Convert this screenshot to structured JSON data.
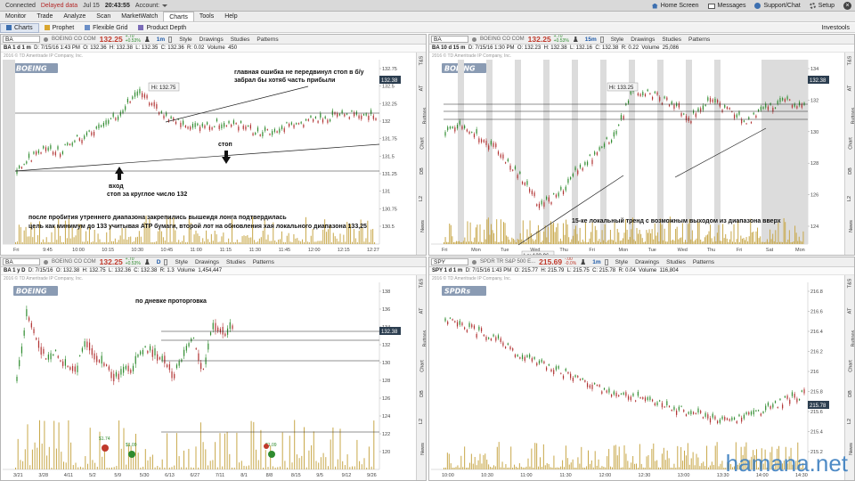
{
  "topbar": {
    "connected": "Connected",
    "delayed": "Delayed data",
    "date": "Jul 15",
    "time": "20:43:55",
    "account_label": "Account:",
    "home": "Home Screen",
    "messages": "Messages",
    "support": "Support/Chat",
    "setup": "Setup"
  },
  "main_tabs": [
    "Monitor",
    "Trade",
    "Analyze",
    "Scan",
    "MarketWatch",
    "Charts",
    "Tools",
    "Help"
  ],
  "active_tab": "Charts",
  "subnav": {
    "items": [
      "Charts",
      "Prophet",
      "Flexible Grid",
      "Product Depth"
    ],
    "right": "Investools"
  },
  "panes": [
    {
      "symbol": "BA",
      "period": "BA 1 d 1 m",
      "company": "BOEING CO COM",
      "last": "132.25",
      "change": "+.70",
      "change_pct": "+0.53%",
      "interval": "1m",
      "ohlc": {
        "date": "D: 7/15/16 1:43 PM",
        "o": "O: 132.36",
        "h": "H: 132.38",
        "l": "L: 132.35",
        "c": "C: 132.36",
        "r": "R: 0.02",
        "vol_label": "Volume",
        "vol": "450"
      },
      "price_tag": "132.38",
      "hi_label": "Hi: 132.75",
      "y_ticks": [
        "132.75",
        "132.5",
        "132.25",
        "132",
        "131.75",
        "131.5",
        "131.25",
        "131",
        "130.75",
        "130.5"
      ],
      "x_ticks": [
        "Fri",
        "9:45",
        "10:00",
        "10:15",
        "10:30",
        "10:45",
        "11:00",
        "11:15",
        "11:30",
        "11:45",
        "12:00",
        "12:15",
        "12:27"
      ],
      "notes": {
        "error": "главная ошибка  не передвинул стоп в б/у",
        "error2": "забрал бы хотяб часть прибыли",
        "stop": "стоп",
        "entry": "вход",
        "entry2": "стоп за круглое число 132",
        "after": "после пробития утреннего диапазона закрепились вышеидя лонга подтвердилась",
        "after2": "цель как минимум до 133 учитывая ATP бумаги, второй лот на обновления хая локального диапазона 133,25"
      }
    },
    {
      "symbol": "BA",
      "period": "BA 10 d 15 m",
      "company": "BOEING CO COM",
      "last": "132.25",
      "change": "+.70",
      "change_pct": "+0.53%",
      "interval": "15m",
      "ohlc": {
        "date": "D: 7/15/16 1:30 PM",
        "o": "O: 132.23",
        "h": "H: 132.38",
        "l": "L: 132.16",
        "c": "C: 132.38",
        "r": "R: 0.22",
        "vol_label": "Volume",
        "vol": "25,086"
      },
      "price_tag": "132.38",
      "hi_label": "Hi: 133.25",
      "lo_label": "Lo: 123.96",
      "y_ticks": [
        "134",
        "132",
        "130",
        "128",
        "126",
        "124"
      ],
      "x_ticks": [
        "Fri",
        "Mon",
        "Tue",
        "Wed",
        "Thu",
        "Fri",
        "Mon",
        "Tue",
        "Wed",
        "Thu",
        "Fri",
        "Sat",
        "Mon"
      ],
      "notes": {
        "trend": "15-ке локальный тренд с возможным выходом из диапазона вверх"
      }
    },
    {
      "symbol": "BA",
      "period": "BA 1 y D",
      "company": "BOEING CO COM",
      "last": "132.25",
      "change": "+.70",
      "change_pct": "+0.53%",
      "interval": "D",
      "ohlc": {
        "date": "D: 7/15/16",
        "o": "O: 132.38",
        "h": "H: 132.75",
        "l": "L: 132.36",
        "c": "C: 132.38",
        "r": "R: 1.3",
        "vol_label": "Volume",
        "vol": "1,454,447"
      },
      "price_tag": "132.38",
      "y_ticks": [
        "138",
        "136",
        "134",
        "132",
        "130",
        "128",
        "126",
        "124",
        "122",
        "120"
      ],
      "x_ticks": [
        "3/21",
        "3/28",
        "4/11",
        "5/2",
        "5/9",
        "5/30",
        "6/13",
        "6/27",
        "7/11",
        "8/1",
        "8/8",
        "8/15",
        "9/5",
        "9/12",
        "9/26"
      ],
      "dividends": [
        "$1.74",
        "$1.09",
        "$1.09"
      ],
      "notes": {
        "daily": "по дневке проторговка"
      }
    },
    {
      "symbol": "SPY",
      "period": "SPY 1 d 1 m",
      "company": "SPDR TR S&P 500 E...",
      "last": "215.69",
      "change": "-.00",
      "change_pct": "-0.0%",
      "interval": "1m",
      "ohlc": {
        "date": "D: 7/15/16 1:43 PM",
        "o": "O: 215.77",
        "h": "H: 215.79",
        "l": "L: 215.75",
        "c": "C: 215.78",
        "r": "R: 0.04",
        "vol_label": "Volume",
        "vol": "116,804"
      },
      "price_tag": "215.78",
      "y_ticks": [
        "216.8",
        "216.6",
        "216.4",
        "216.2",
        "216",
        "215.8",
        "215.6",
        "215.4",
        "215.2"
      ],
      "x_ticks": [
        "10:00",
        "10:30",
        "11:00",
        "11:30",
        "12:00",
        "12:30",
        "13:00",
        "13:30",
        "14:00",
        "14:30"
      ]
    }
  ],
  "toolbar": {
    "style": "Style",
    "drawings": "Drawings",
    "studies": "Studies",
    "patterns": "Patterns"
  },
  "side_tabs": [
    "T&S",
    "AT",
    "Buttons",
    "Chart",
    "DB",
    "L2",
    "News"
  ],
  "watermark": "hamana.net",
  "copyright": "2016 © TD Ameritrade IP Company, Inc."
}
